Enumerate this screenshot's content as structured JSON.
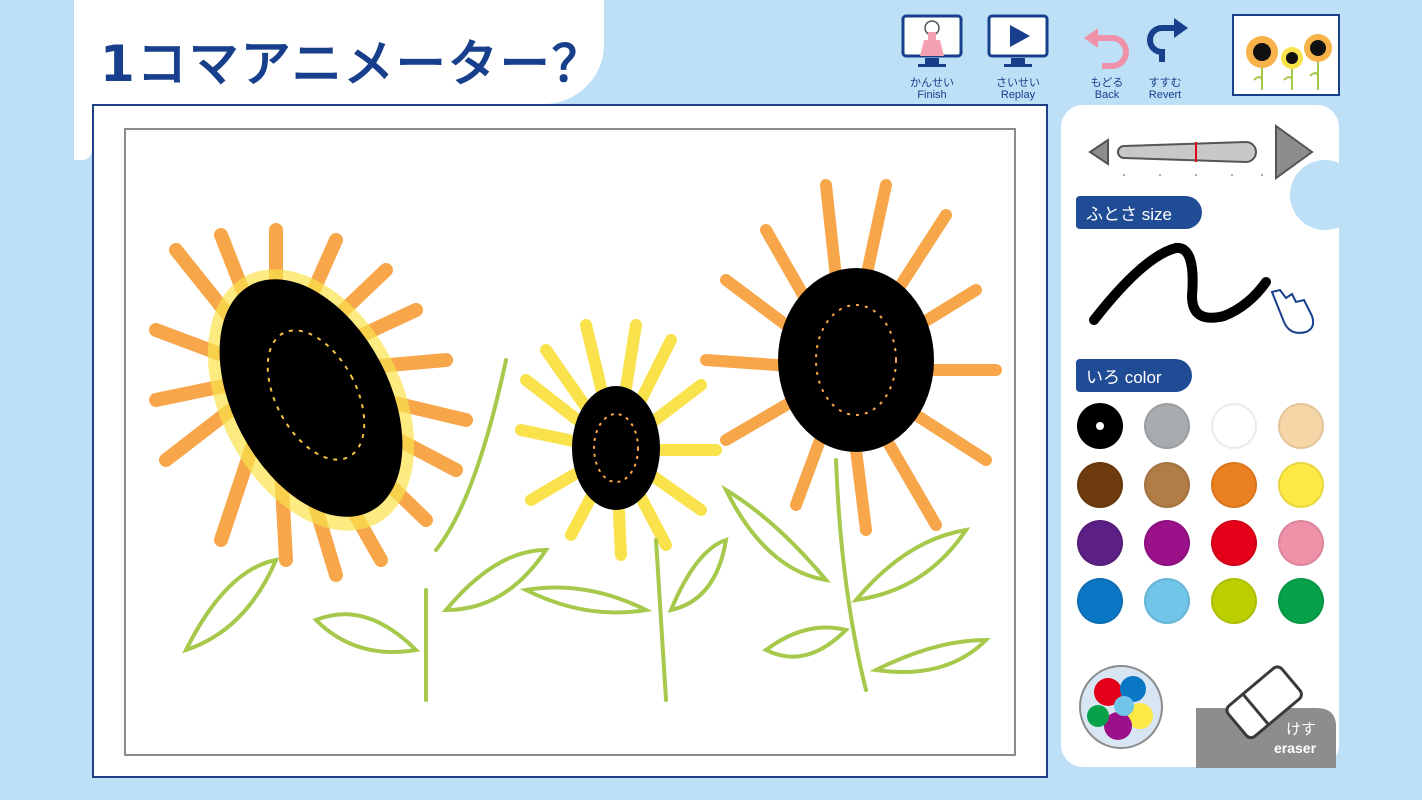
{
  "app": {
    "title": "1コマアニメーター？"
  },
  "toolbar": {
    "finish": {
      "jp": "かんせい",
      "en": "Finish"
    },
    "replay": {
      "jp": "さいせい",
      "en": "Replay"
    },
    "back": {
      "jp": "もどる",
      "en": "Back"
    },
    "revert": {
      "jp": "すすむ",
      "en": "Revert"
    }
  },
  "size_section": {
    "label": "ふとさ  size",
    "slider_fraction": 0.52
  },
  "color_section": {
    "label": "いろ color",
    "selected": "black",
    "swatches": [
      {
        "name": "black",
        "hex": "#000000"
      },
      {
        "name": "gray",
        "hex": "#a8acaf"
      },
      {
        "name": "white",
        "hex": "#ffffff"
      },
      {
        "name": "beige",
        "hex": "#f6d6a6"
      },
      {
        "name": "brown",
        "hex": "#6e3b0e"
      },
      {
        "name": "light-brown",
        "hex": "#b07d47"
      },
      {
        "name": "orange",
        "hex": "#ea8020"
      },
      {
        "name": "yellow",
        "hex": "#fde945"
      },
      {
        "name": "purple",
        "hex": "#5b1f85"
      },
      {
        "name": "magenta",
        "hex": "#9b118a"
      },
      {
        "name": "red",
        "hex": "#e30018"
      },
      {
        "name": "pink",
        "hex": "#ef92a9"
      },
      {
        "name": "blue",
        "hex": "#0a77c4"
      },
      {
        "name": "sky-blue",
        "hex": "#70c5e8"
      },
      {
        "name": "yellow-green",
        "hex": "#bccf00"
      },
      {
        "name": "green",
        "hex": "#06a24a"
      }
    ]
  },
  "eraser": {
    "jp": "けす",
    "en": "eraser"
  },
  "colors": {
    "accent": "#173f8c",
    "background": "#bde0f6"
  }
}
